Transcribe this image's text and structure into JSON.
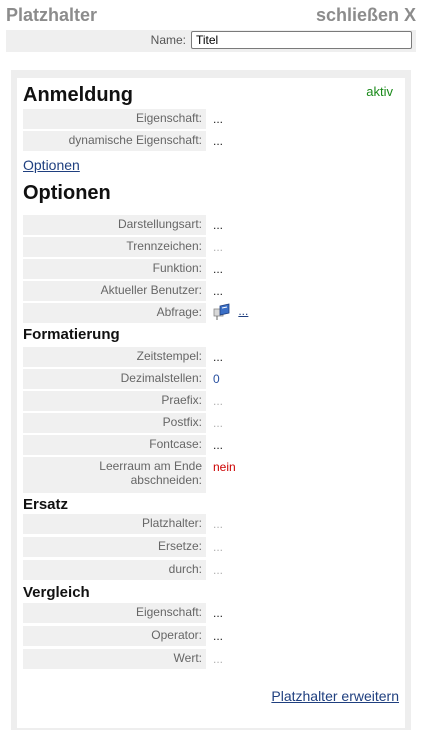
{
  "header": {
    "title": "Platzhalter",
    "close_label": "schließen X"
  },
  "name_field": {
    "label": "Name:",
    "value": "Titel"
  },
  "anmeldung": {
    "title": "Anmeldung",
    "status": "aktiv",
    "rows": [
      {
        "label": "Eigenschaft:",
        "value": "..."
      },
      {
        "label": "dynamische Eigenschaft:",
        "value": "..."
      }
    ],
    "options_link": "Optionen"
  },
  "optionen": {
    "title": "Optionen",
    "rows": [
      {
        "label": "Darstellungsart:",
        "value": "..."
      },
      {
        "label": "Trennzeichen:",
        "value": "..."
      },
      {
        "label": "Funktion:",
        "value": "..."
      },
      {
        "label": "Aktueller Benutzer:",
        "value": "..."
      },
      {
        "label": "Abfrage:",
        "value": "..."
      }
    ]
  },
  "formatierung": {
    "title": "Formatierung",
    "rows": [
      {
        "label": "Zeitstempel:",
        "value": "..."
      },
      {
        "label": "Dezimalstellen:",
        "value": "0"
      },
      {
        "label": "Praefix:",
        "value": "..."
      },
      {
        "label": "Postfix:",
        "value": "..."
      },
      {
        "label": "Fontcase:",
        "value": "..."
      },
      {
        "label_line1": "Leerraum am Ende",
        "label_line2": "abschneiden:",
        "value": "nein"
      }
    ]
  },
  "ersatz": {
    "title": "Ersatz",
    "rows": [
      {
        "label": "Platzhalter:",
        "value": "..."
      },
      {
        "label": "Ersetze:",
        "value": "..."
      },
      {
        "label": "durch:",
        "value": "..."
      }
    ]
  },
  "vergleich": {
    "title": "Vergleich",
    "rows": [
      {
        "label": "Eigenschaft:",
        "value": "..."
      },
      {
        "label": "Operator:",
        "value": "..."
      },
      {
        "label": "Wert:",
        "value": "..."
      }
    ]
  },
  "footer_link": "Platzhalter erweitern",
  "colors": {
    "active": "#1a8a1a",
    "no": "#cc0000",
    "link": "#1f3f7f",
    "number": "#2850a0"
  }
}
